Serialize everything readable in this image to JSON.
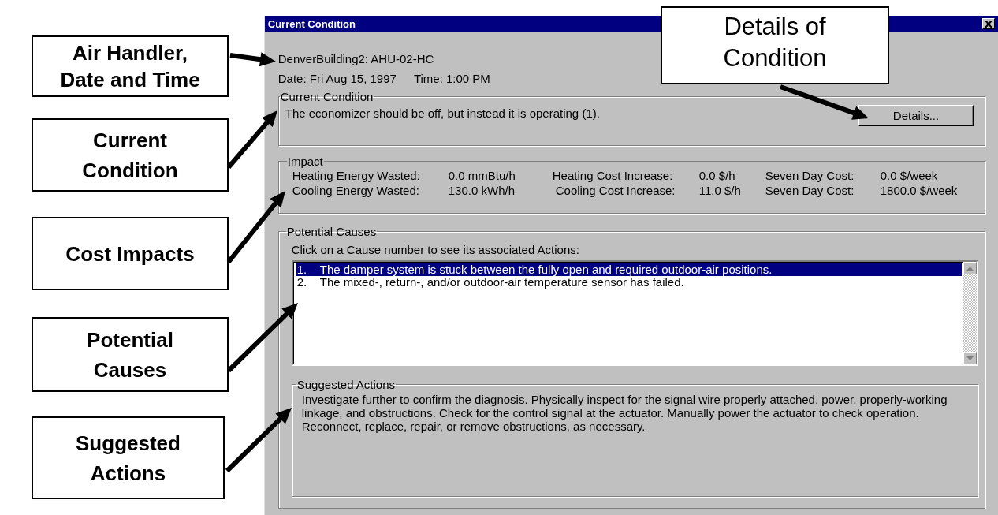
{
  "callouts": [
    {
      "text": "Air Handler, Date and Time"
    },
    {
      "text": "Current Condition"
    },
    {
      "text": "Cost Impacts"
    },
    {
      "text": "Potential Causes"
    },
    {
      "text": "Suggested Actions"
    }
  ],
  "details_callout": {
    "text": "Details of Condition"
  },
  "window": {
    "title": "Current Condition"
  },
  "air_handler": "DenverBuilding2: AHU-02-HC",
  "date": "Date: Fri Aug 15, 1997",
  "time": "Time: 1:00 PM",
  "current_condition": {
    "legend": "Current Condition",
    "text": "The economizer should be off, but instead it is operating (1).",
    "button": "Details..."
  },
  "impact": {
    "legend": "Impact",
    "rows": [
      [
        {
          "label": "Heating Energy Wasted:",
          "value": "0.0 mmBtu/h"
        },
        {
          "label": "Heating Cost Increase:",
          "value": "0.0 $/h"
        },
        {
          "label": "Seven Day Cost:",
          "value": "0.0 $/week"
        }
      ],
      [
        {
          "label": "Cooling Energy Wasted:",
          "value": "130.0 kWh/h"
        },
        {
          "label": "Cooling Cost Increase:",
          "value": "11.0 $/h"
        },
        {
          "label": "Seven Day Cost:",
          "value": "1800.0 $/week"
        }
      ]
    ]
  },
  "potential_causes": {
    "legend": "Potential Causes",
    "instruction": "Click on a Cause number to see its associated Actions:",
    "items": [
      {
        "number": "1.",
        "text": "The damper system is stuck between the fully open and required outdoor-air positions.",
        "selected": true
      },
      {
        "number": "2.",
        "text": "The mixed-, return-, and/or outdoor-air temperature sensor has failed.",
        "selected": false
      }
    ]
  },
  "suggested_actions": {
    "legend": "Suggested Actions",
    "text": "Investigate further to confirm the diagnosis.  Physically inspect for the signal wire properly attached, power, properly-working linkage, and obstructions.  Check for the control signal at the actuator.  Manually power the actuator to check operation.  Reconnect, replace, repair, or remove obstructions, as necessary."
  }
}
